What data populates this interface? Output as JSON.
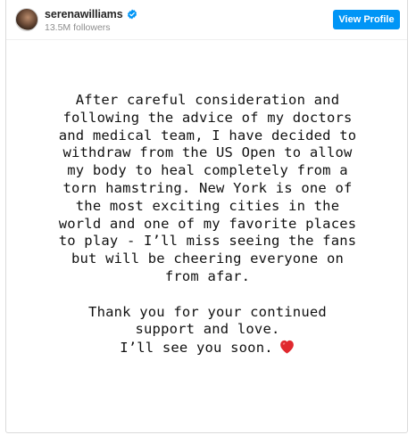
{
  "header": {
    "username": "serenawilliams",
    "followers": "13.5M followers",
    "view_profile_label": "View Profile",
    "verified_icon": "verified-badge-icon",
    "accent_color": "#0095f6"
  },
  "story": {
    "paragraph1": [
      "After careful consideration and",
      "following the advice of my doctors",
      "and medical team, I have decided to",
      "withdraw from the US Open to allow",
      "my body to heal completely from a",
      "torn hamstring. New York is one of",
      "the most exciting cities in the",
      "world and one of my favorite places",
      "to play - I’ll miss seeing the fans",
      "but will be cheering everyone on",
      "from afar."
    ],
    "paragraph2": [
      "Thank you for your continued",
      "support and love.",
      "I’ll see you soon."
    ],
    "emoji_icon": "red-heart-icon"
  }
}
